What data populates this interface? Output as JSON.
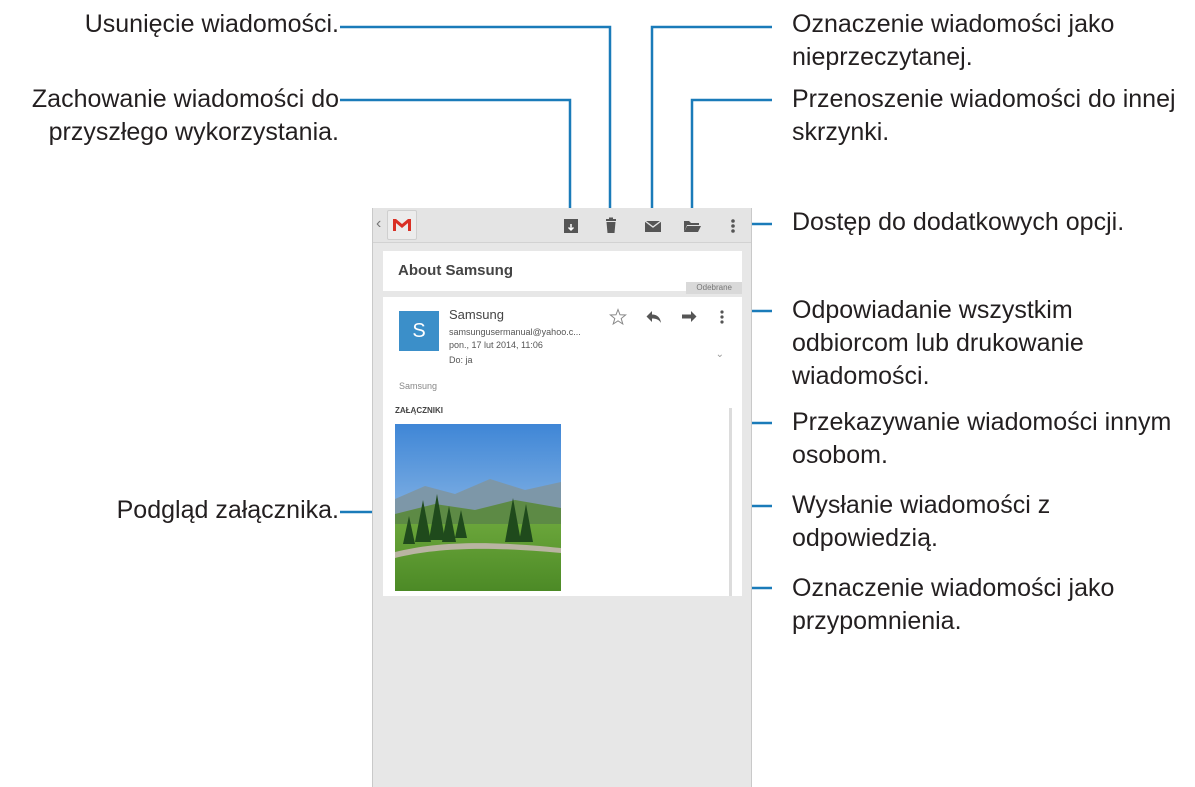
{
  "callouts": {
    "delete": "Usunięcie wiadomości.",
    "archive_line1": "Zachowanie wiadomości do",
    "archive_line2": "przyszłego wykorzystania.",
    "preview": "Podgląd załącznika.",
    "unread_line1": "Oznaczenie wiadomości jako",
    "unread_line2": "nieprzeczytanej.",
    "move_line1": "Przenoszenie wiadomości do innej",
    "move_line2": "skrzynki.",
    "more_options": "Dostęp do dodatkowych opcji.",
    "reply_all_line1": "Odpowiadanie wszystkim",
    "reply_all_line2": "odbiorcom lub drukowanie",
    "reply_all_line3": "wiadomości.",
    "forward_line1": "Przekazywanie wiadomości innym",
    "forward_line2": "osobom.",
    "reply_line1": "Wysłanie wiadomości z",
    "reply_line2": "odpowiedzią.",
    "star_line1": "Oznaczenie wiadomości jako",
    "star_line2": "przypomnienia."
  },
  "email": {
    "subject": "About Samsung",
    "label": "Odebrane",
    "avatar_letter": "S",
    "sender_name": "Samsung",
    "sender_email": "samsungusermanual@yahoo.c...",
    "date": "pon., 17 lut 2014, 11:06",
    "to": "Do: ja",
    "body": "Samsung",
    "attachments_heading": "ZAŁĄCZNIKI"
  },
  "colors": {
    "callout_line": "#1a7bb9",
    "avatar": "#3b8fc9",
    "gmail_red": "#d93025"
  }
}
